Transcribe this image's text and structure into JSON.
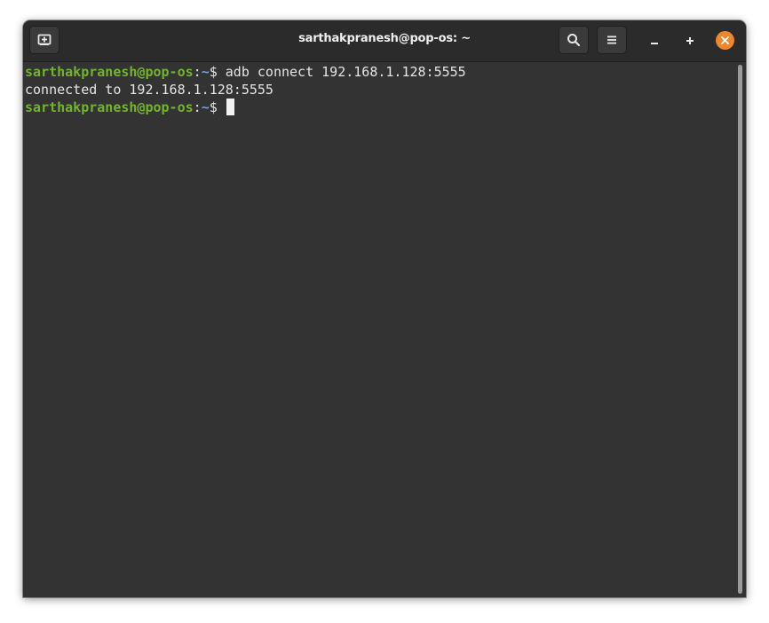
{
  "window": {
    "title": "sarthakpranesh@pop-os: ~"
  },
  "header": {
    "new_tab_icon": "new-tab-icon",
    "search_icon": "search-icon",
    "menu_icon": "hamburger-menu-icon",
    "minimize_icon": "minimize-icon",
    "maximize_icon": "maximize-icon",
    "close_icon": "close-icon"
  },
  "colors": {
    "prompt_user": "#73b32e",
    "prompt_path": "#6f9fd8",
    "close_button": "#f0862b",
    "background": "#333333"
  },
  "terminal": {
    "lines": [
      {
        "prompt_user": "sarthakpranesh@pop-os",
        "prompt_colon": ":",
        "prompt_path": "~",
        "prompt_symbol": "$ ",
        "command": "adb connect 192.168.1.128:5555"
      },
      {
        "output": "connected to 192.168.1.128:5555"
      },
      {
        "prompt_user": "sarthakpranesh@pop-os",
        "prompt_colon": ":",
        "prompt_path": "~",
        "prompt_symbol": "$ ",
        "command": ""
      }
    ]
  }
}
